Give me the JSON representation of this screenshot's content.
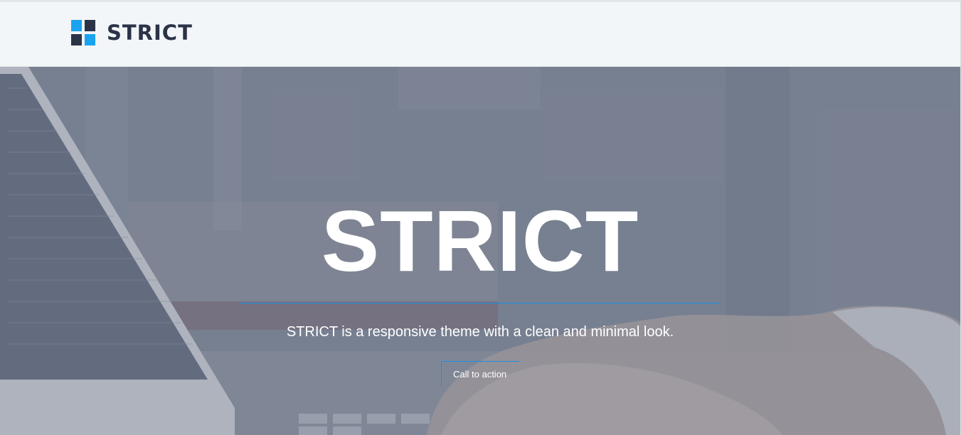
{
  "brand": {
    "name": "STRICT"
  },
  "hero": {
    "title": "STRICT",
    "subtitle": "STRICT is a responsive theme with a clean and minimal look.",
    "cta_label": "Call to action"
  },
  "colors": {
    "accent": "#1aa3f0",
    "dark": "#2b3347",
    "header_bg": "#f3f6f8",
    "divider": "#1a8fe0"
  }
}
